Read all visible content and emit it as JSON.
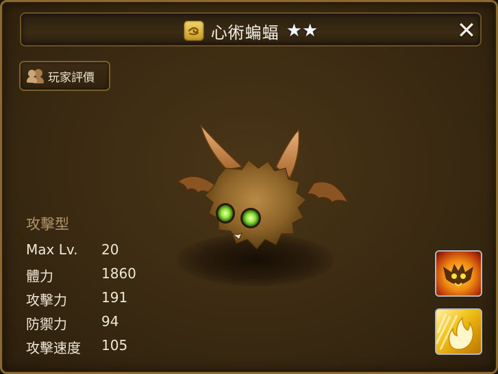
{
  "header": {
    "element_icon": "wind-element-icon",
    "title": "心術蝙蝠",
    "star_count": 2,
    "star_glyph": "★",
    "close_glyph": "✕"
  },
  "review_button": {
    "label": "玩家評價",
    "icon": "players-icon"
  },
  "monster": {
    "type_label": "攻擊型",
    "name": "心術蝙蝠"
  },
  "stats": [
    {
      "label": "Max Lv.",
      "value": "20"
    },
    {
      "label": "體力",
      "value": "1860"
    },
    {
      "label": "攻擊力",
      "value": "191"
    },
    {
      "label": "防禦力",
      "value": "94"
    },
    {
      "label": "攻擊速度",
      "value": "105"
    }
  ],
  "skills": [
    {
      "icon": "bat-screech-skill-icon"
    },
    {
      "icon": "flame-burst-skill-icon"
    }
  ],
  "colors": {
    "panel_border": "#8a6a2e",
    "label_tan": "#b3946a",
    "text_light": "#efe8d7"
  }
}
